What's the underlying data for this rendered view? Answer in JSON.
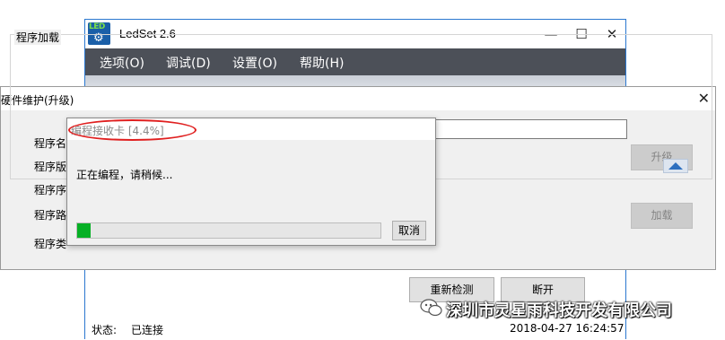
{
  "main_window": {
    "title": "LedSet 2.6",
    "minimize_glyph": "—",
    "maximize_glyph": "☐",
    "close_glyph": "✕",
    "logo_text": "LED",
    "logo_icon": "gear-icon",
    "menu": [
      {
        "label": "选项(O)"
      },
      {
        "label": "调试(D)"
      },
      {
        "label": "设置(O)"
      },
      {
        "label": "帮助(H)"
      }
    ],
    "redetect_label": "重新检测",
    "disconnect_label": "断开",
    "status_label": "状态:",
    "status_value": "已连接",
    "status_time": "2018-04-27 16:24:57"
  },
  "hw_dialog": {
    "title": "硬件维护(升级)",
    "close_glyph": "✕",
    "group_title": "程序加载",
    "labels": [
      "程序名",
      "程序版",
      "程序序",
      "程序路",
      "程序类"
    ],
    "upgrade_label": "升级",
    "load_label": "加载"
  },
  "progress_dialog": {
    "title": "编程接收卡 [4.4%]",
    "message": "正在编程，请稍候...",
    "progress_fraction": 0.044,
    "cancel_label": "取消"
  },
  "watermark": {
    "text": "深圳市灵星雨科技开发有限公司",
    "icon": "wechat-icon"
  },
  "colors": {
    "menubar": "#4c5058",
    "progress": "#06b025",
    "highlight_ellipse": "#e02020",
    "window_border": "#2b78d0"
  }
}
